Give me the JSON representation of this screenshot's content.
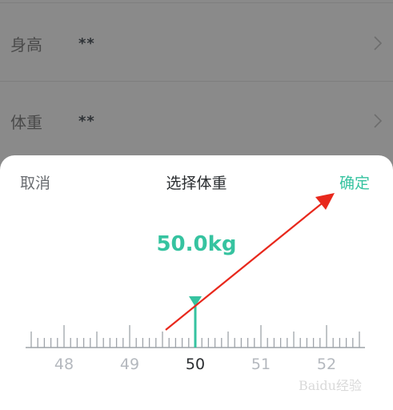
{
  "profile": {
    "rows": [
      {
        "label": "身高",
        "value": "**"
      },
      {
        "label": "体重",
        "value": "**"
      }
    ]
  },
  "picker": {
    "cancel_label": "取消",
    "title": "选择体重",
    "confirm_label": "确定",
    "current_weight": "50.0kg",
    "ruler_labels": [
      "48",
      "49",
      "50",
      "51",
      "52"
    ],
    "selected_value": 50.0,
    "range_min": 47.5,
    "range_max": 52.6
  },
  "colors": {
    "accent": "#36c3a0",
    "annotation_arrow": "#e8281c",
    "overlay": "#8a8a8a"
  },
  "watermark": "Baidu经验"
}
